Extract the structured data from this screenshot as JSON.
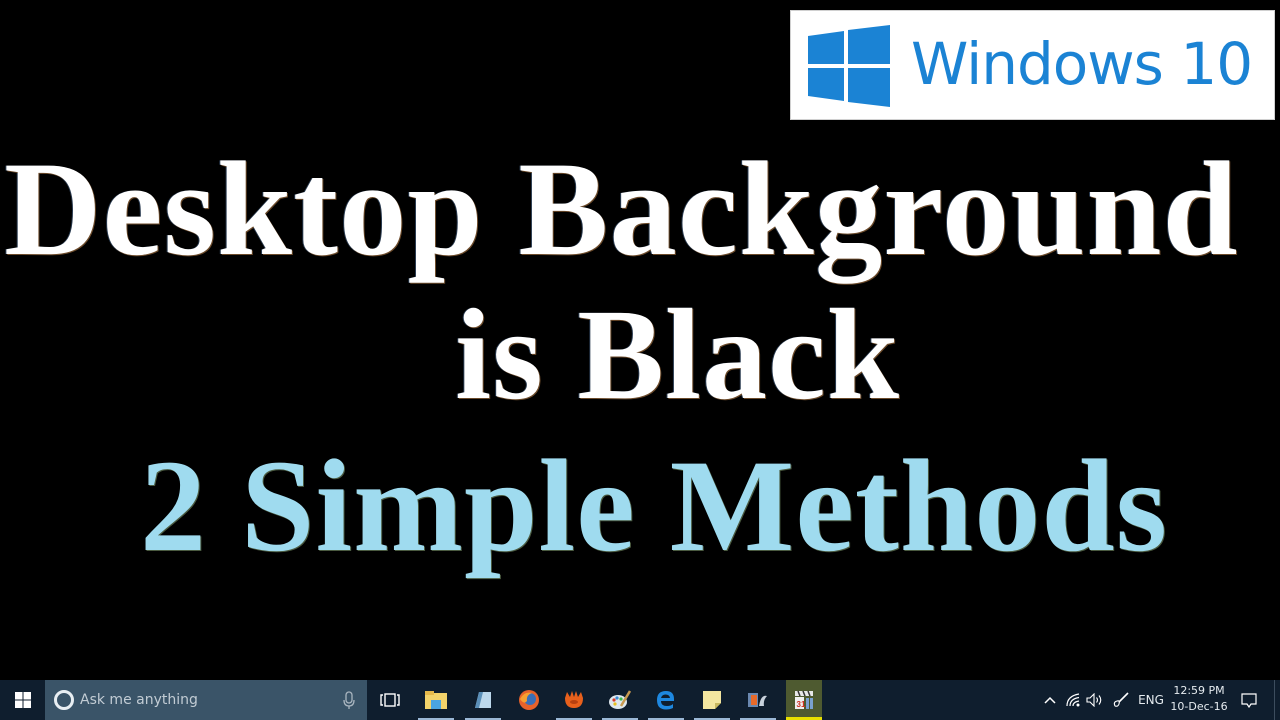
{
  "desktop": {
    "background_color": "#000000",
    "logo": {
      "icon": "windows-logo-icon",
      "text": "Windows 10",
      "color": "#1b83d4"
    },
    "title_lines": [
      {
        "text": "Desktop Background",
        "color": "#ffffff"
      },
      {
        "text": "is Black",
        "color": "#ffffff"
      },
      {
        "text": "2 Simple Methods",
        "color": "#9fdbef"
      }
    ]
  },
  "taskbar": {
    "start": {
      "icon": "windows-start-icon",
      "label": "Start"
    },
    "search": {
      "icon": "cortana-icon",
      "placeholder": "Ask me anything",
      "mic_icon": "microphone-icon"
    },
    "task_view": {
      "icon": "task-view-icon",
      "label": "Task View"
    },
    "apps": [
      {
        "name": "File Explorer",
        "icon": "file-explorer-icon",
        "running": true
      },
      {
        "name": "Notepad",
        "icon": "notepad-icon",
        "running": true
      },
      {
        "name": "Firefox",
        "icon": "firefox-icon",
        "running": false
      },
      {
        "name": "Mitten app",
        "icon": "orange-glove-icon",
        "running": true
      },
      {
        "name": "Paint",
        "icon": "paint-palette-icon",
        "running": true
      },
      {
        "name": "Microsoft Edge",
        "icon": "edge-icon",
        "running": true
      },
      {
        "name": "Sticky Notes",
        "icon": "sticky-notes-icon",
        "running": true
      },
      {
        "name": "Video Editor",
        "icon": "film-editor-icon",
        "running": true
      },
      {
        "name": "Movie Maker",
        "icon": "movie-clapper-icon",
        "running": true,
        "active": true
      }
    ],
    "tray": {
      "overflow_icon": "chevron-up-icon",
      "network_icon": "wifi-icon",
      "volume_icon": "speaker-icon",
      "pen_icon": "pen-icon",
      "language": "ENG",
      "time": "12:59 PM",
      "date": "10-Dec-16",
      "notifications_icon": "action-center-icon"
    }
  }
}
